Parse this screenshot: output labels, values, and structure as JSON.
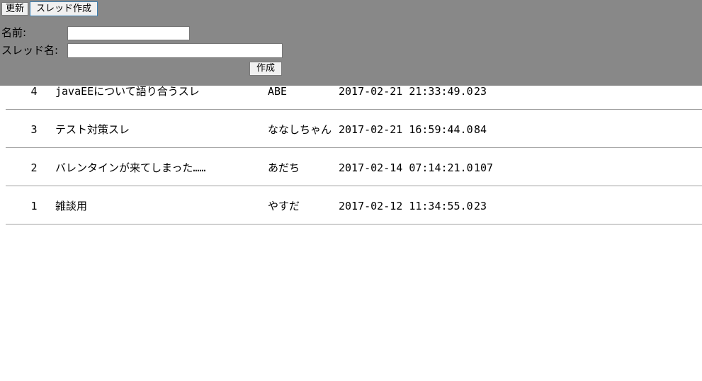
{
  "toolbar": {
    "refresh_label": "更新",
    "create_thread_label": "スレッド作成"
  },
  "form": {
    "name_label": "名前:",
    "name_value": "",
    "thread_name_label": "スレッド名:",
    "thread_name_value": "",
    "submit_label": "作成"
  },
  "threads": [
    {
      "id": "4",
      "title": "javaEEについて語り合うスレ",
      "author": "ABE",
      "created": "2017-02-21 21:33:49.0",
      "count": "23"
    },
    {
      "id": "3",
      "title": "テスト対策スレ",
      "author": "ななしちゃん",
      "created": "2017-02-21 16:59:44.0",
      "count": "84"
    },
    {
      "id": "2",
      "title": "バレンタインが来てしまった……",
      "author": "あだち",
      "created": "2017-02-14 07:14:21.0",
      "count": "107"
    },
    {
      "id": "1",
      "title": "雑談用",
      "author": "やすだ",
      "created": "2017-02-12 11:34:55.0",
      "count": "23"
    }
  ],
  "colors": {
    "panel_background": "#888888",
    "row_divider": "#a0a0a0"
  }
}
